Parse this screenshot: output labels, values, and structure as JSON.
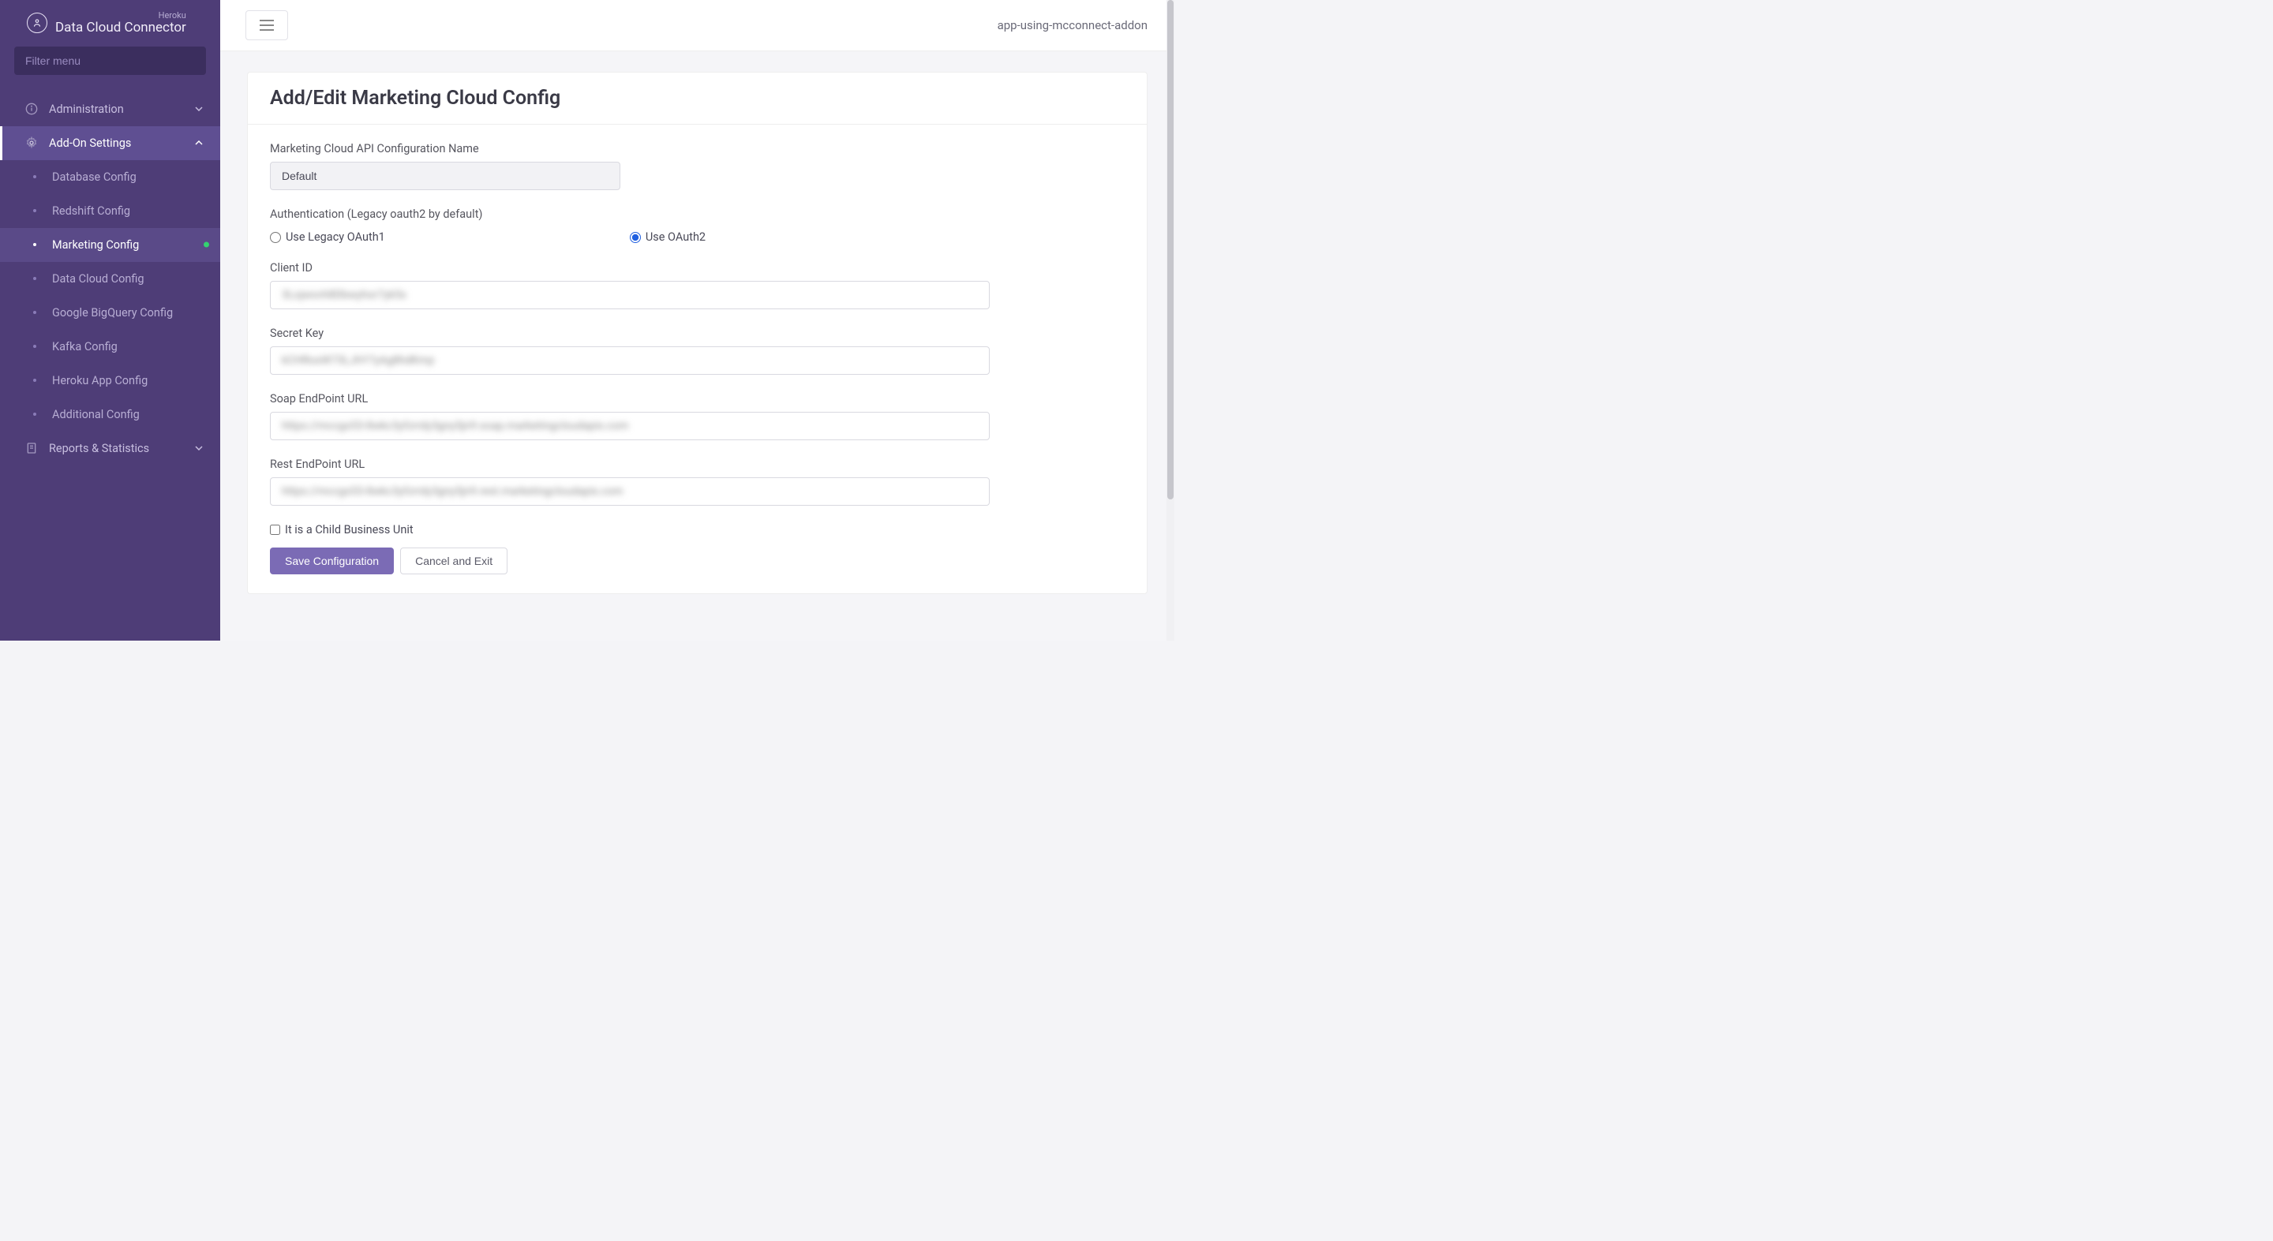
{
  "brand": {
    "super": "Heroku",
    "title": "Data Cloud Connector"
  },
  "sidebar": {
    "filter_placeholder": "Filter menu",
    "groups": [
      {
        "label": "Administration",
        "icon": "info"
      },
      {
        "label": "Add-On Settings",
        "icon": "gear",
        "active": true
      },
      {
        "label": "Reports & Statistics",
        "icon": "doc"
      }
    ],
    "addon_items": [
      {
        "label": "Database Config"
      },
      {
        "label": "Redshift Config"
      },
      {
        "label": "Marketing Config",
        "active": true,
        "status_dot": true
      },
      {
        "label": "Data Cloud Config"
      },
      {
        "label": "Google BigQuery Config"
      },
      {
        "label": "Kafka Config"
      },
      {
        "label": "Heroku App Config"
      },
      {
        "label": "Additional Config"
      }
    ]
  },
  "topbar": {
    "app_name": "app-using-mcconnect-addon"
  },
  "panel": {
    "title": "Add/Edit Marketing Cloud Config"
  },
  "form": {
    "config_name_label": "Marketing Cloud API Configuration Name",
    "config_name_value": "Default",
    "auth_label": "Authentication (Legacy oauth2 by default)",
    "auth_opt1": "Use Legacy OAuth1",
    "auth_opt2": "Use OAuth2",
    "auth_selected": "oauth2",
    "client_id_label": "Client ID",
    "client_id_value": "3Lojwsvh8Dbwyhor7yk5x",
    "secret_key_label": "Secret Key",
    "secret_key_value": "kCHRosW73LJhY7yAg8hdKmp",
    "soap_label": "Soap EndPoint URL",
    "soap_value": "https://mccgs53-8wkc3yfzrrdy3gny5jn9.soap.marketingcloudapis.com",
    "rest_label": "Rest EndPoint URL",
    "rest_value": "https://mccgs53-8wkc3yfzrrdy3gny5jn9.rest.marketingcloudapis.com",
    "child_bu_label": "It is a Child Business Unit",
    "child_bu_checked": false,
    "save_label": "Save Configuration",
    "cancel_label": "Cancel and Exit"
  }
}
